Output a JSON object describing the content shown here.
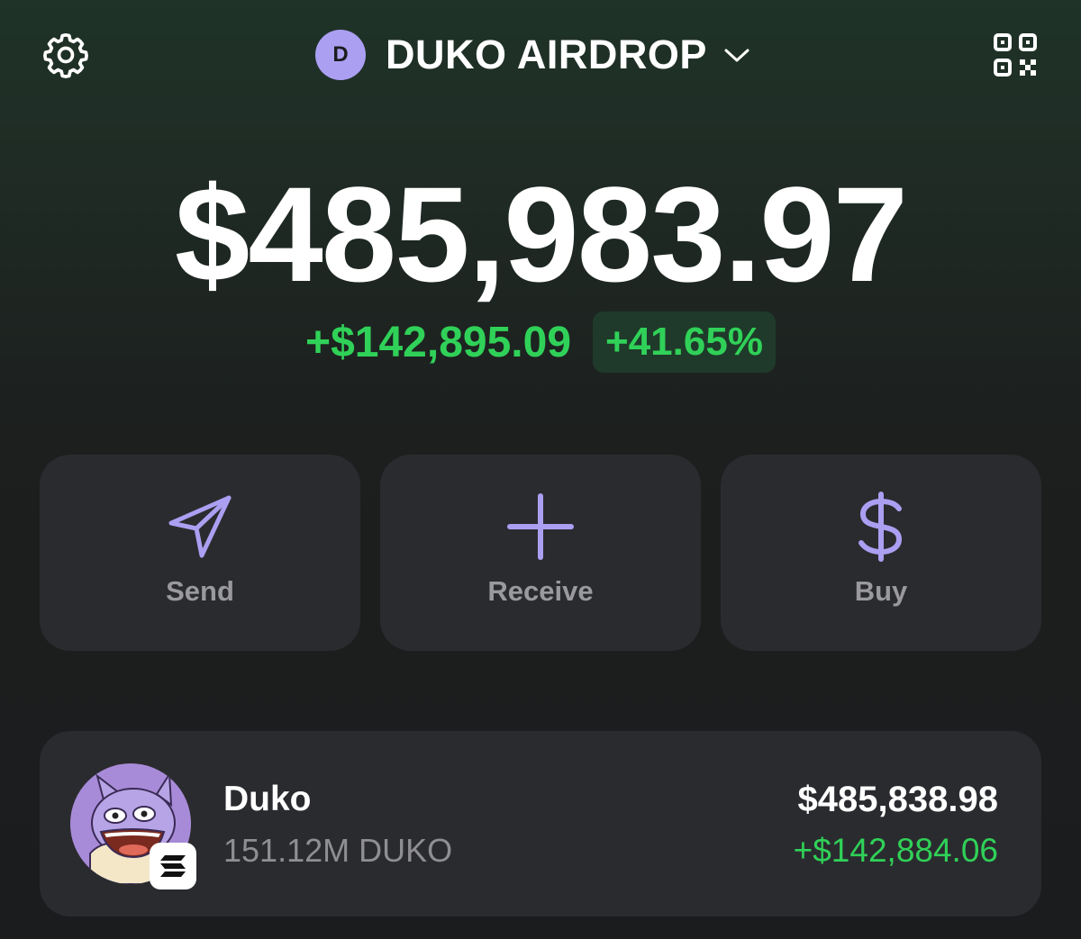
{
  "header": {
    "account_initial": "D",
    "account_name": "DUKO AIRDROP",
    "settings_icon": "gear-icon",
    "qr_icon": "qr-code-icon",
    "chevron_icon": "chevron-down-icon"
  },
  "portfolio": {
    "balance": "$485,983.97",
    "change_value": "+$142,895.09",
    "change_percent": "+41.65%"
  },
  "actions": [
    {
      "label": "Send",
      "icon": "send-icon"
    },
    {
      "label": "Receive",
      "icon": "plus-icon"
    },
    {
      "label": "Buy",
      "icon": "dollar-icon"
    }
  ],
  "tokens": [
    {
      "name": "Duko",
      "amount": "151.12M DUKO",
      "value": "$485,838.98",
      "change": "+$142,884.06",
      "chain_icon": "solana-icon"
    }
  ],
  "colors": {
    "accent": "#ab9ff2",
    "positive": "#30d158",
    "card": "#2a2b2f",
    "muted": "#9a9a9e"
  }
}
